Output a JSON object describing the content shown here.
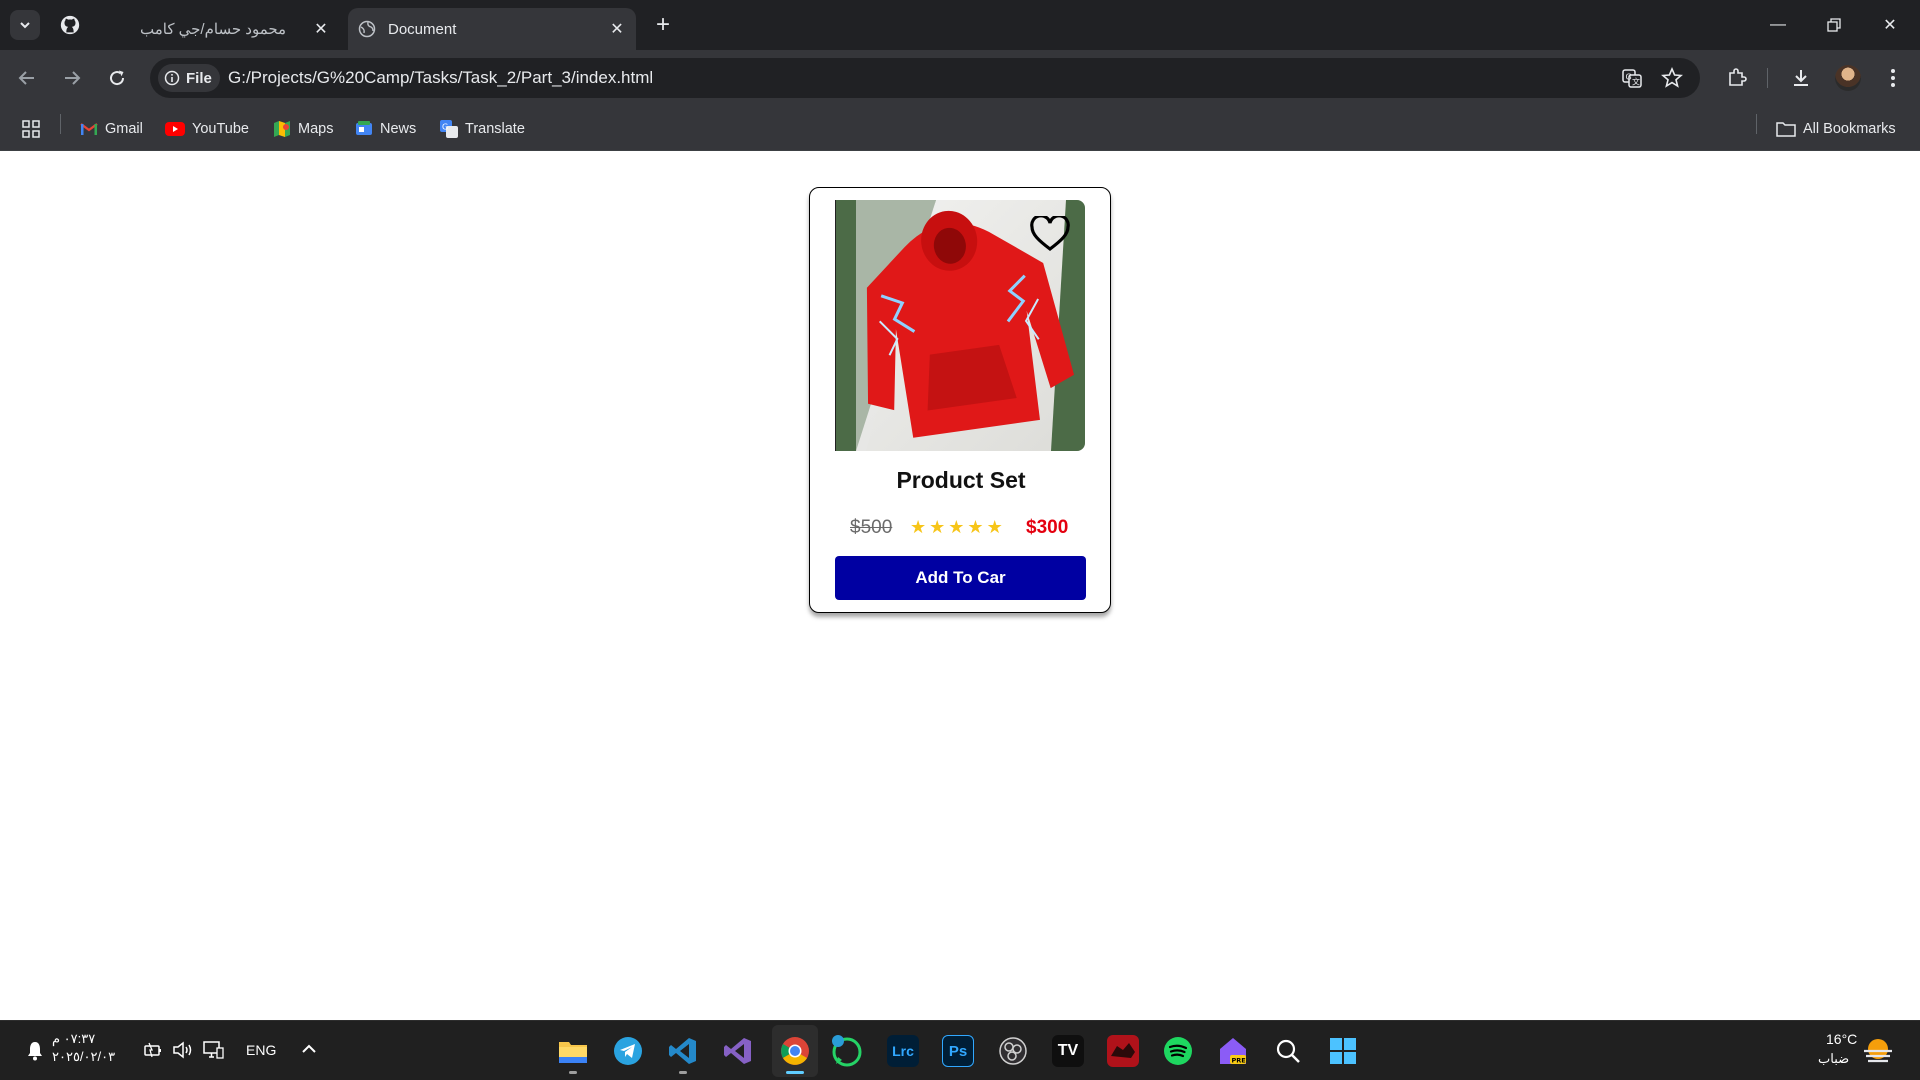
{
  "browser": {
    "tabs": [
      {
        "title": "محمود حسام/جي كامب",
        "active": false
      },
      {
        "title": "Document",
        "active": true
      }
    ],
    "address": {
      "chip_label": "File",
      "url": "G:/Projects/G%20Camp/Tasks/Task_2/Part_3/index.html"
    },
    "bookmarks": [
      {
        "label": "Gmail",
        "icon": "gmail-icon"
      },
      {
        "label": "YouTube",
        "icon": "youtube-icon"
      },
      {
        "label": "Maps",
        "icon": "maps-icon"
      },
      {
        "label": "News",
        "icon": "news-icon"
      },
      {
        "label": "Translate",
        "icon": "translate-icon"
      }
    ],
    "all_bookmarks_label": "All Bookmarks"
  },
  "product": {
    "title": "Product Set",
    "old_price": "$500",
    "new_price": "$300",
    "rating": 5,
    "button_label": "Add To Car",
    "colors": {
      "button": "#0000a2",
      "new_price": "#e4000f",
      "star": "#f7c518"
    }
  },
  "taskbar": {
    "time": "٠٧:٣٧ م",
    "date": "٢٠٢٥/٠٢/٠٣",
    "language": "ENG",
    "weather_temp": "16°C",
    "weather_desc": "ضباب",
    "apps": [
      "file-explorer",
      "telegram",
      "vscode",
      "visual-studio",
      "chrome",
      "whatsapp",
      "lightroom-classic",
      "photoshop",
      "obs",
      "tradingview",
      "game",
      "spotify",
      "home-pre",
      "search",
      "start"
    ]
  }
}
